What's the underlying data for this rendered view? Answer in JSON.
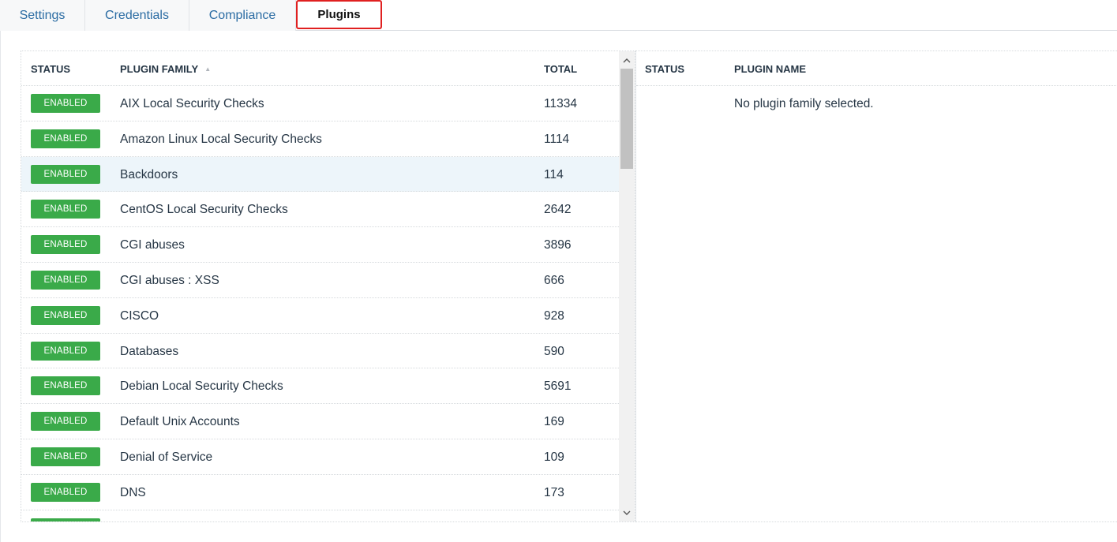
{
  "tabs": [
    {
      "label": "Settings"
    },
    {
      "label": "Credentials"
    },
    {
      "label": "Compliance"
    },
    {
      "label": "Plugins"
    }
  ],
  "families_table": {
    "headers": {
      "status": "STATUS",
      "family": "PLUGIN FAMILY",
      "total": "TOTAL"
    },
    "sort_icon": "sort-ascending-icon",
    "rows": [
      {
        "status": "ENABLED",
        "family": "AIX Local Security Checks",
        "total": "11334"
      },
      {
        "status": "ENABLED",
        "family": "Amazon Linux Local Security Checks",
        "total": "1114"
      },
      {
        "status": "ENABLED",
        "family": "Backdoors",
        "total": "114"
      },
      {
        "status": "ENABLED",
        "family": "CentOS Local Security Checks",
        "total": "2642"
      },
      {
        "status": "ENABLED",
        "family": "CGI abuses",
        "total": "3896"
      },
      {
        "status": "ENABLED",
        "family": "CGI abuses : XSS",
        "total": "666"
      },
      {
        "status": "ENABLED",
        "family": "CISCO",
        "total": "928"
      },
      {
        "status": "ENABLED",
        "family": "Databases",
        "total": "590"
      },
      {
        "status": "ENABLED",
        "family": "Debian Local Security Checks",
        "total": "5691"
      },
      {
        "status": "ENABLED",
        "family": "Default Unix Accounts",
        "total": "169"
      },
      {
        "status": "ENABLED",
        "family": "Denial of Service",
        "total": "109"
      },
      {
        "status": "ENABLED",
        "family": "DNS",
        "total": "173"
      },
      {
        "status": "ENABLED",
        "family": "",
        "total": ""
      }
    ]
  },
  "plugins_table": {
    "headers": {
      "status": "STATUS",
      "name": "PLUGIN NAME"
    },
    "empty_message": "No plugin family selected."
  },
  "colors": {
    "enabled_badge": "#3aaa49",
    "tab_link": "#2b6ca3",
    "active_tab_outline": "#e02020",
    "selected_row": "#edf5fa"
  }
}
